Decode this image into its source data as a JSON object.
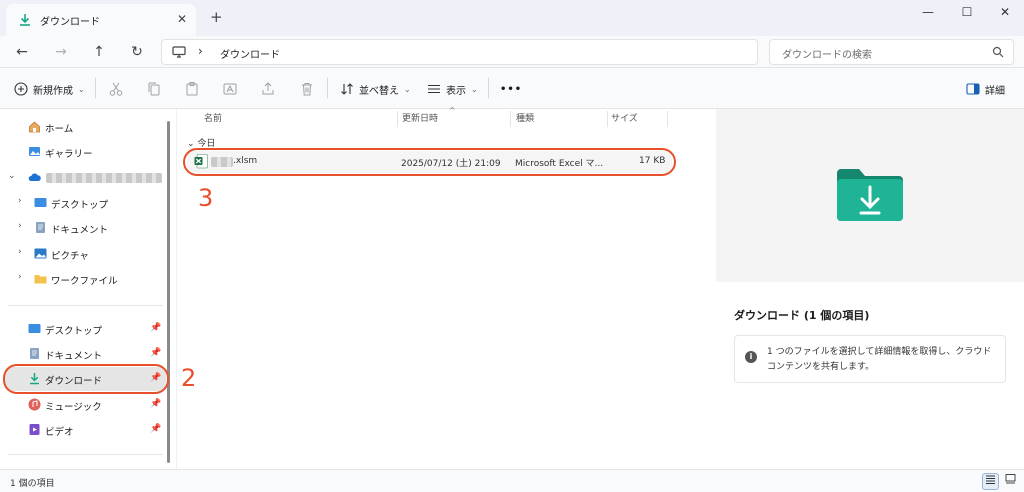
{
  "window": {
    "tab_title": "ダウンロード",
    "tab_close": "✕",
    "new_tab": "+",
    "controls": {
      "minimize": "—",
      "maximize": "☐",
      "close": "✕"
    }
  },
  "nav": {
    "back": "←",
    "forward": "→",
    "up": "↑",
    "refresh": "↻",
    "address_sep": "›",
    "address_text": "ダウンロード",
    "search_placeholder": "ダウンロードの検索"
  },
  "toolbar": {
    "new_label": "新規作成",
    "sort_label": "並べ替え",
    "view_label": "表示",
    "more": "•••",
    "details_label": "詳細"
  },
  "sidebar": {
    "home": "ホーム",
    "gallery": "ギャラリー",
    "desktop": "デスクトップ",
    "documents": "ドキュメント",
    "pictures": "ピクチャ",
    "work_files": "ワークファイル",
    "quick_desktop": "デスクトップ",
    "quick_documents": "ドキュメント",
    "quick_downloads": "ダウンロード",
    "quick_music": "ミュージック",
    "quick_videos": "ビデオ"
  },
  "list": {
    "columns": {
      "name": "名前",
      "modified": "更新日時",
      "type": "種類",
      "size": "サイズ"
    },
    "group": "今日",
    "files": [
      {
        "name": ".xlsm",
        "modified": "2025/07/12 (土) 21:09",
        "type": "Microsoft Excel マ...",
        "size": "17 KB"
      }
    ]
  },
  "preview": {
    "title": "ダウンロード (1 個の項目)",
    "info": "1 つのファイルを選択して詳細情報を取得し、クラウド コンテンツを共有します。"
  },
  "status": {
    "count": "1 個の項目"
  },
  "annotations": {
    "step2": "2",
    "step3": "3"
  },
  "colors": {
    "accent": "#e8502a",
    "folder": "#1aa889",
    "excel": "#1e7145"
  }
}
